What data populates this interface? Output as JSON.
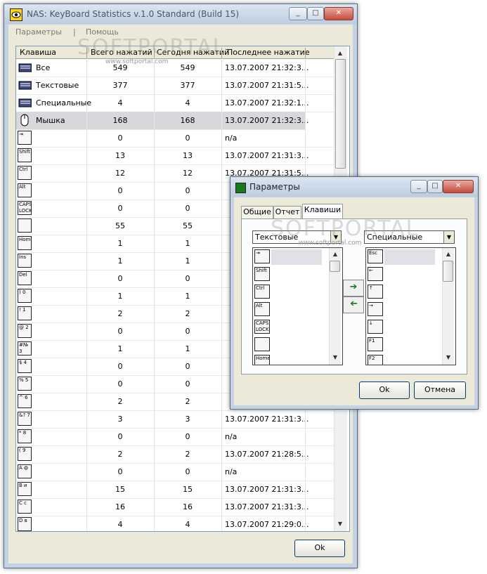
{
  "main_window": {
    "title": "NAS: KeyBoard Statistics v.1.0 Standard (Build 15)",
    "icon": "eye-icon",
    "controls": [
      "_",
      "□",
      "✕"
    ],
    "menu": [
      "Параметры",
      "|",
      "Помощь"
    ],
    "columns": [
      "Клавиша",
      "Всего нажатий",
      "Сегодня нажатий",
      "Последнее нажатие"
    ],
    "rows": [
      {
        "key": "keyboard-icon",
        "name": "Все",
        "total": "549",
        "today": "549",
        "last": "13.07.2007 21:32:3..."
      },
      {
        "key": "keyboard-icon",
        "name": "Текстовые",
        "total": "377",
        "today": "377",
        "last": "13.07.2007 21:31:5..."
      },
      {
        "key": "keyboard-icon",
        "name": "Специальные",
        "total": "4",
        "today": "4",
        "last": "13.07.2007 21:32:1..."
      },
      {
        "key": "mouse-icon",
        "name": "Мышка",
        "total": "168",
        "today": "168",
        "last": "13.07.2007 21:32:3..."
      },
      {
        "key": "⇥",
        "name": "",
        "total": "0",
        "today": "0",
        "last": "n/a"
      },
      {
        "key": "Shift",
        "name": "",
        "total": "13",
        "today": "13",
        "last": "13.07.2007 21:31:3..."
      },
      {
        "key": "Ctrl",
        "name": "",
        "total": "12",
        "today": "12",
        "last": "13.07.2007 21:31:5..."
      },
      {
        "key": "Alt",
        "name": "",
        "total": "0",
        "today": "0",
        "last": ""
      },
      {
        "key": "CAPS LOCK",
        "name": "",
        "total": "0",
        "today": "0",
        "last": ""
      },
      {
        "key": "",
        "name": "",
        "total": "55",
        "today": "55",
        "last": ""
      },
      {
        "key": "Home",
        "name": "",
        "total": "1",
        "today": "1",
        "last": ""
      },
      {
        "key": "Ins",
        "name": "",
        "total": "1",
        "today": "1",
        "last": ""
      },
      {
        "key": "Del",
        "name": "",
        "total": "0",
        "today": "0",
        "last": ""
      },
      {
        "key": ") 0",
        "name": "",
        "total": "1",
        "today": "1",
        "last": ""
      },
      {
        "key": "! 1",
        "name": "",
        "total": "2",
        "today": "2",
        "last": ""
      },
      {
        "key": "@ 2",
        "name": "",
        "total": "0",
        "today": "0",
        "last": ""
      },
      {
        "key": "#№ 3",
        "name": "",
        "total": "1",
        "today": "1",
        "last": ""
      },
      {
        "key": "$ 4",
        "name": "",
        "total": "0",
        "today": "0",
        "last": ""
      },
      {
        "key": "% 5",
        "name": "",
        "total": "0",
        "today": "0",
        "last": ""
      },
      {
        "key": "^ 6",
        "name": "",
        "total": "2",
        "today": "2",
        "last": ""
      },
      {
        "key": "&? 7",
        "name": "",
        "total": "3",
        "today": "3",
        "last": "13.07.2007 21:31:3..."
      },
      {
        "key": "* 8",
        "name": "",
        "total": "0",
        "today": "0",
        "last": "n/a"
      },
      {
        "key": "( 9",
        "name": "",
        "total": "2",
        "today": "2",
        "last": "13.07.2007 21:28:5..."
      },
      {
        "key": "A ф",
        "name": "",
        "total": "0",
        "today": "0",
        "last": "n/a"
      },
      {
        "key": "B и",
        "name": "",
        "total": "15",
        "today": "15",
        "last": "13.07.2007 21:31:3..."
      },
      {
        "key": "C с",
        "name": "",
        "total": "16",
        "today": "16",
        "last": "13.07.2007 21:31:3..."
      },
      {
        "key": "D в",
        "name": "",
        "total": "4",
        "today": "4",
        "last": "13.07.2007 21:29:0..."
      }
    ],
    "ok_label": "Ok"
  },
  "dialog": {
    "title": "Параметры",
    "controls": [
      "_",
      "□",
      "✕"
    ],
    "tabs": [
      "Общие",
      "Отчет",
      "Клавиши"
    ],
    "active_tab": "Клавиши",
    "left_combo": "Текстовые",
    "right_combo": "Специальные",
    "left_keys": [
      "⇥",
      "Shift",
      "Ctrl",
      "Alt",
      "CAPS LOCK",
      "",
      "Home"
    ],
    "right_keys": [
      "Esc",
      "←",
      "↑",
      "→",
      "↓",
      "F1",
      "F2"
    ],
    "move_right_icon": "arrow-right-icon",
    "move_left_icon": "arrow-left-icon",
    "ok_label": "Ok",
    "cancel_label": "Отмена"
  },
  "watermark": {
    "brand": "SOFTPORTAL",
    "url": "www.softportal.com"
  }
}
